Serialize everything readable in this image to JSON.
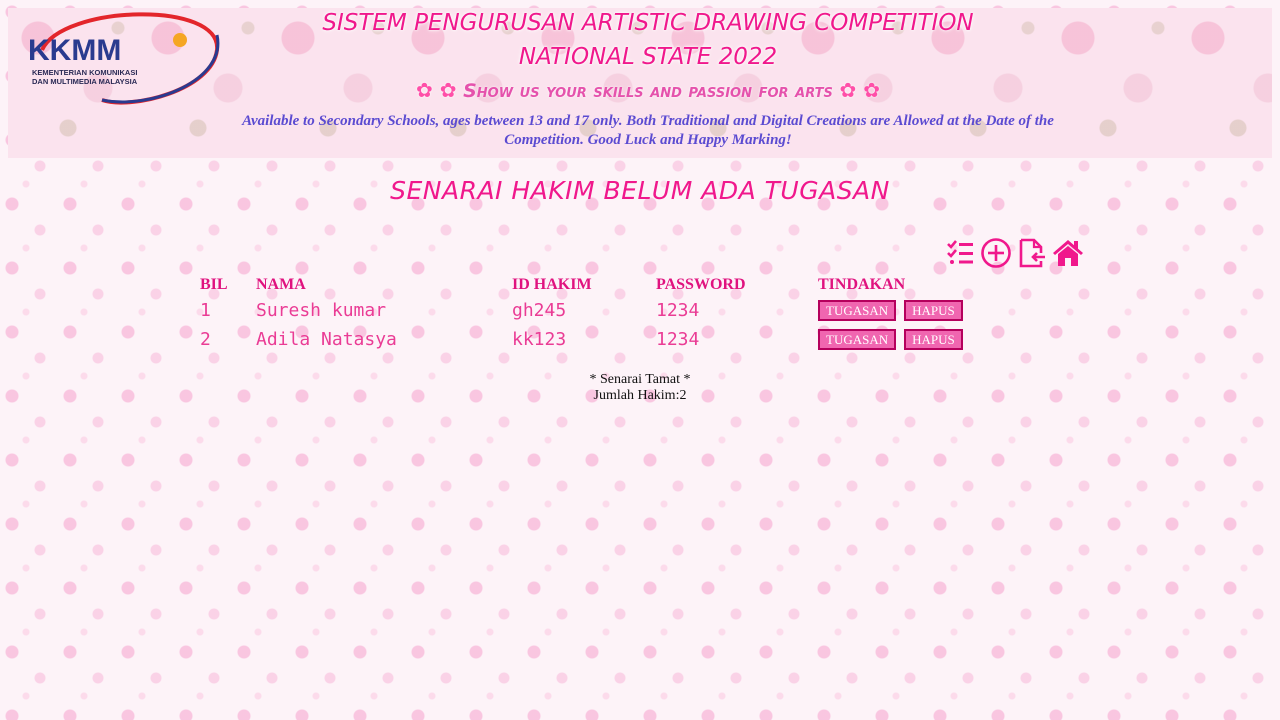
{
  "header": {
    "logo_text": "KKMM",
    "logo_sub_line1": "KEMENTERIAN KOMUNIKASI",
    "logo_sub_line2": "DAN MULTIMEDIA MALAYSIA",
    "title_line1": "SISTEM PENGURUSAN ARTISTIC DRAWING COMPETITION",
    "title_line2": "NATIONAL STATE 2022",
    "tagline": "Show us your skills and passion for arts",
    "note": "Available to Secondary Schools, ages between 13 and 17 only. Both Traditional and Digital Creations are Allowed at the Date of the Competition. Good Luck and Happy Marking!"
  },
  "page": {
    "title": "SENARAI HAKIM BELUM ADA TUGASAN"
  },
  "toolbar": {
    "icons": [
      "checklist-icon",
      "add-circle-icon",
      "file-export-icon",
      "home-icon"
    ],
    "accent_color": "#f0188c"
  },
  "table": {
    "headers": {
      "bil": "BIL",
      "nama": "NAMA",
      "id": "ID HAKIM",
      "password": "PASSWORD",
      "action": "TINDAKAN"
    },
    "rows": [
      {
        "bil": "1",
        "nama": "Suresh kumar",
        "id": "gh245",
        "password": "1234",
        "assign_label": "TUGASAN",
        "delete_label": "HAPUS"
      },
      {
        "bil": "2",
        "nama": "Adila Natasya",
        "id": "kk123",
        "password": "1234",
        "assign_label": "TUGASAN",
        "delete_label": "HAPUS"
      }
    ]
  },
  "footer": {
    "end_text": "* Senarai Tamat *",
    "total_text": "Jumlah Hakim:2"
  },
  "colors": {
    "primary_pink": "#f0188c",
    "button_bg": "#f066b0",
    "button_border": "#b5005d",
    "note_purple": "#5b4bd1",
    "logo_blue": "#2a3b8f"
  }
}
